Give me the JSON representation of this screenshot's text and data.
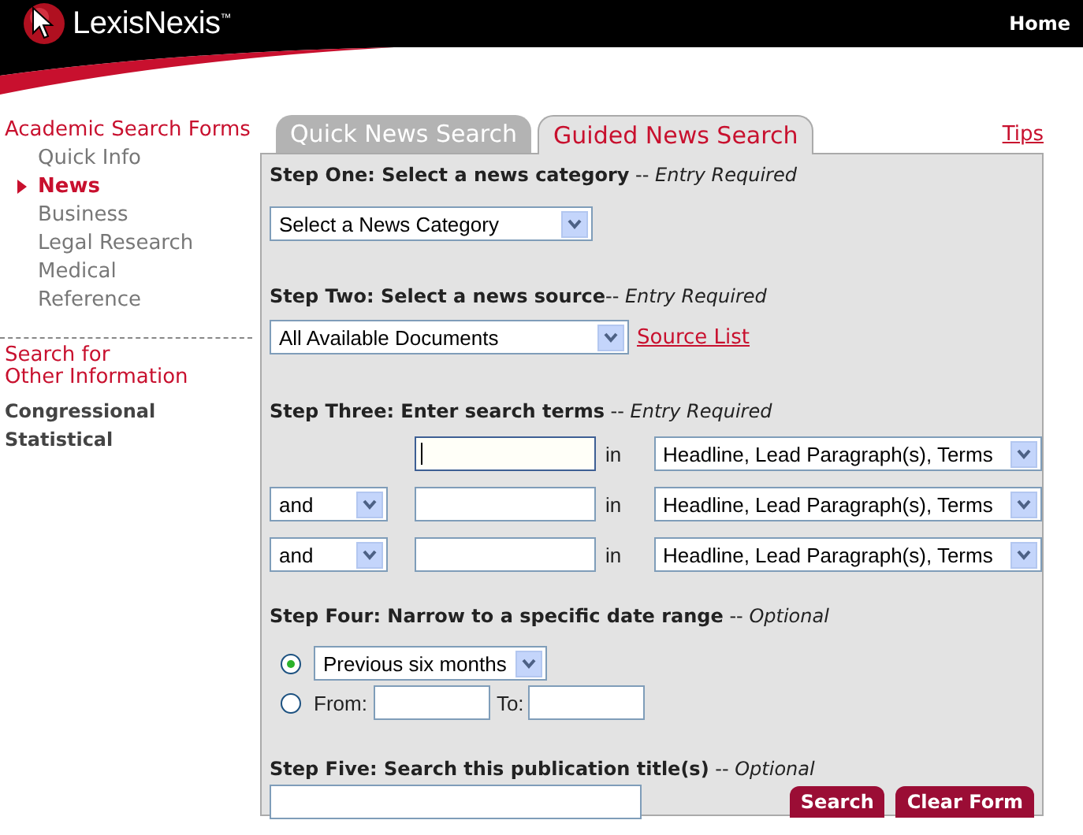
{
  "header": {
    "logo": "LexisNexis$^{™}$",
    "home": "Home"
  },
  "sidebar": {
    "heading": "Academic Search Forms",
    "items": [
      {
        "label": "Quick Info",
        "selected": false
      },
      {
        "label": "News",
        "selected": true
      },
      {
        "label": "Business",
        "selected": false
      },
      {
        "label": "Legal Research",
        "selected": false
      },
      {
        "label": "Medical",
        "selected": false
      },
      {
        "label": "Reference",
        "selected": false
      }
    ],
    "other_heading": [
      "Search for",
      "Other Information"
    ],
    "other_links": [
      "Congressional",
      "Statistical"
    ]
  },
  "tabs": [
    {
      "label": "Quick News Search",
      "selected": false
    },
    {
      "label": "Guided News Search",
      "selected": true
    }
  ],
  "tips": "Tips",
  "step_one": {
    "title": "**Step One: Select a news category** -- *Entry Required*",
    "select": "Select a News Category"
  },
  "step_two": {
    "title": "**Step Two: Select a news source**-- *Entry Required*",
    "select": "All Available Documents",
    "link": "Source List"
  },
  "step_three": {
    "title": "**Step Three: Enter search terms** -- *Entry Required*",
    "rows": [
      {
        "focused": true,
        "in": "in",
        "field": "Headline, Lead Paragraph(s), Terms"
      },
      {
        "connector": "and",
        "focused": false,
        "in": "in",
        "field": "Headline, Lead Paragraph(s), Terms"
      },
      {
        "connector": "and",
        "focused": false,
        "in": "in",
        "field": "Headline, Lead Paragraph(s), Terms"
      }
    ]
  },
  "step_four": {
    "title": "**Step Four: Narrow to a specific date range** -- *Optional*",
    "options": [
      {
        "kind": "preset",
        "selected": true,
        "select": "Previous six months"
      },
      {
        "kind": "range",
        "selected": false,
        "from_label": "From:",
        "to_label": "To:"
      }
    ]
  },
  "step_five": {
    "title": "**Step Five: Search this publication title(s)** -- *Optional*"
  },
  "buttons": [
    "Search",
    "Clear Form"
  ]
}
